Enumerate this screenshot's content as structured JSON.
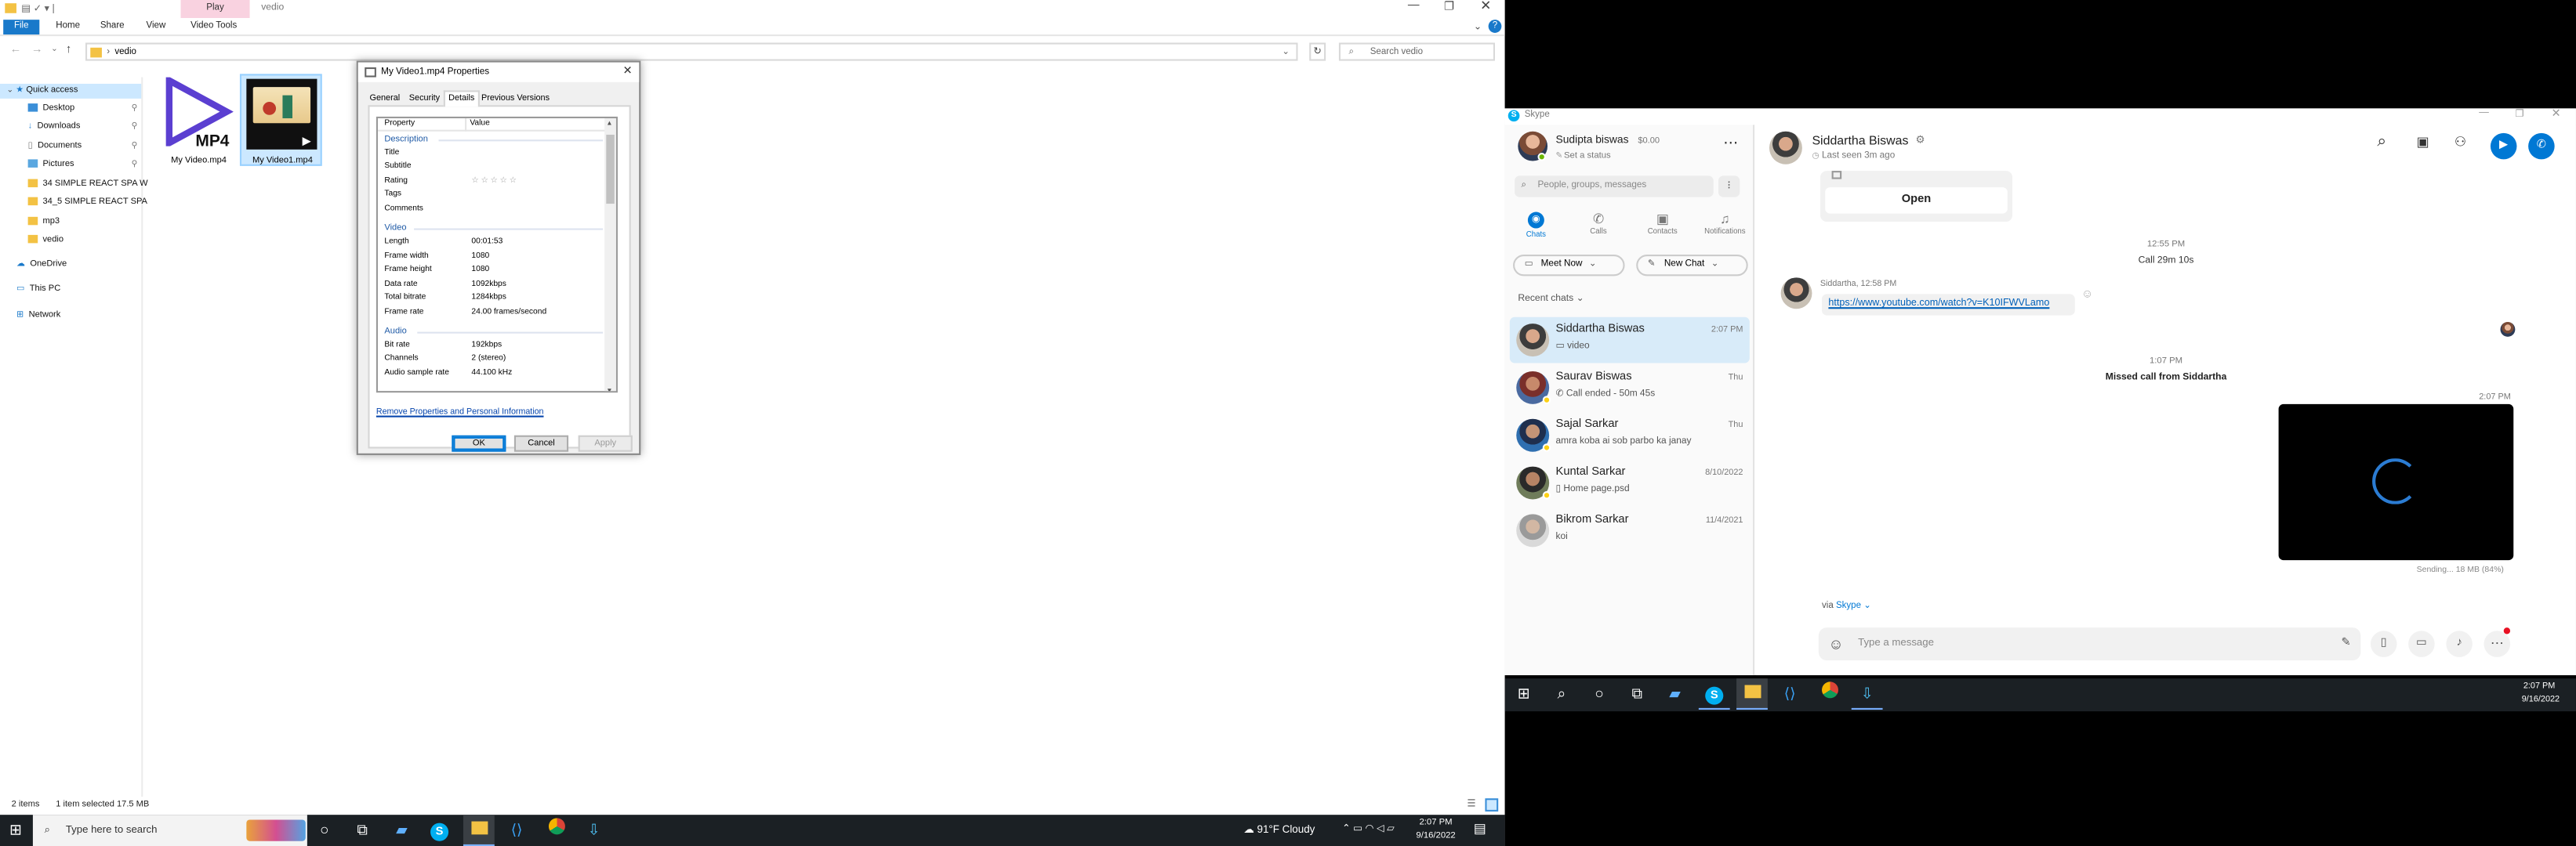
{
  "explorer": {
    "title": "vedio",
    "play_tab": "Play",
    "ribbon_tabs": [
      "File",
      "Home",
      "Share",
      "View",
      "Video Tools"
    ],
    "address": "vedio",
    "search_placeholder": "Search vedio",
    "nav": {
      "quick_access": "Quick access",
      "desktop": "Desktop",
      "downloads": "Downloads",
      "documents": "Documents",
      "pictures": "Pictures",
      "folder1": "34 SIMPLE REACT SPA W",
      "folder2": "34_5 SIMPLE REACT SPA",
      "mp3": "mp3",
      "vedio": "vedio",
      "onedrive": "OneDrive",
      "this_pc": "This PC",
      "network": "Network"
    },
    "files": [
      {
        "name": "My Video.mp4",
        "badge": "MP4"
      },
      {
        "name": "My Video1.mp4"
      }
    ],
    "status": {
      "items": "2 items",
      "selected": "1 item selected  17.5 MB"
    }
  },
  "dialog": {
    "title": "My Video1.mp4 Properties",
    "tabs": [
      "General",
      "Security",
      "Details",
      "Previous Versions"
    ],
    "col_property": "Property",
    "col_value": "Value",
    "sections": {
      "description": "Description",
      "video": "Video",
      "audio": "Audio"
    },
    "desc_rows": [
      "Title",
      "Subtitle",
      "Rating",
      "Tags",
      "Comments"
    ],
    "rating_stars": "☆ ☆ ☆ ☆ ☆",
    "video_rows": [
      [
        "Length",
        "00:01:53"
      ],
      [
        "Frame width",
        "1080"
      ],
      [
        "Frame height",
        "1080"
      ],
      [
        "Data rate",
        "1092kbps"
      ],
      [
        "Total bitrate",
        "1284kbps"
      ],
      [
        "Frame rate",
        "24.00 frames/second"
      ]
    ],
    "audio_rows": [
      [
        "Bit rate",
        "192kbps"
      ],
      [
        "Channels",
        "2 (stereo)"
      ],
      [
        "Audio sample rate",
        "44.100 kHz"
      ]
    ],
    "remove_link": "Remove Properties and Personal Information",
    "ok": "OK",
    "cancel": "Cancel",
    "apply": "Apply"
  },
  "skype": {
    "app_title": "Skype",
    "profile": {
      "name": "Sudipta biswas",
      "balance": "$0.00",
      "status": "Set a status"
    },
    "search_placeholder": "People, groups, messages",
    "nav": [
      "Chats",
      "Calls",
      "Contacts",
      "Notifications"
    ],
    "meet_now": "Meet Now",
    "new_chat": "New Chat",
    "recent_label": "Recent chats",
    "chats": [
      {
        "name": "Siddartha Biswas",
        "msg": "video",
        "time": "2:07 PM"
      },
      {
        "name": "Saurav Biswas",
        "msg": "Call ended - 50m 45s",
        "time": "Thu"
      },
      {
        "name": "Sajal Sarkar",
        "msg": "amra koba ai sob parbo ka janay",
        "time": "Thu"
      },
      {
        "name": "Kuntal Sarkar",
        "msg": "Home page.psd",
        "time": "8/10/2022"
      },
      {
        "name": "Bikrom Sarkar",
        "msg": "koi",
        "time": "11/4/2021"
      }
    ],
    "conv": {
      "name": "Siddartha Biswas",
      "last_seen": "Last seen 3m ago",
      "open_label": "Open",
      "call_time": "12:55 PM",
      "call_text": "Call 29m 10s",
      "sender": "Siddartha, 12:58 PM",
      "link": "https://www.youtube.com/watch?v=K10IFWVLamo",
      "missed_time": "1:07 PM",
      "missed_text": "Missed call from Siddartha",
      "video_time": "2:07 PM",
      "sending": "Sending... 18 MB (84%)",
      "via": "via",
      "via_app": "Skype",
      "input_placeholder": "Type a message"
    }
  },
  "taskbar_right": {
    "time": "2:07 PM",
    "date": "9/16/2022"
  },
  "taskbar_left": {
    "search_placeholder": "Type here to search",
    "weather": "91°F  Cloudy",
    "time": "2:07 PM",
    "date": "9/16/2022"
  }
}
